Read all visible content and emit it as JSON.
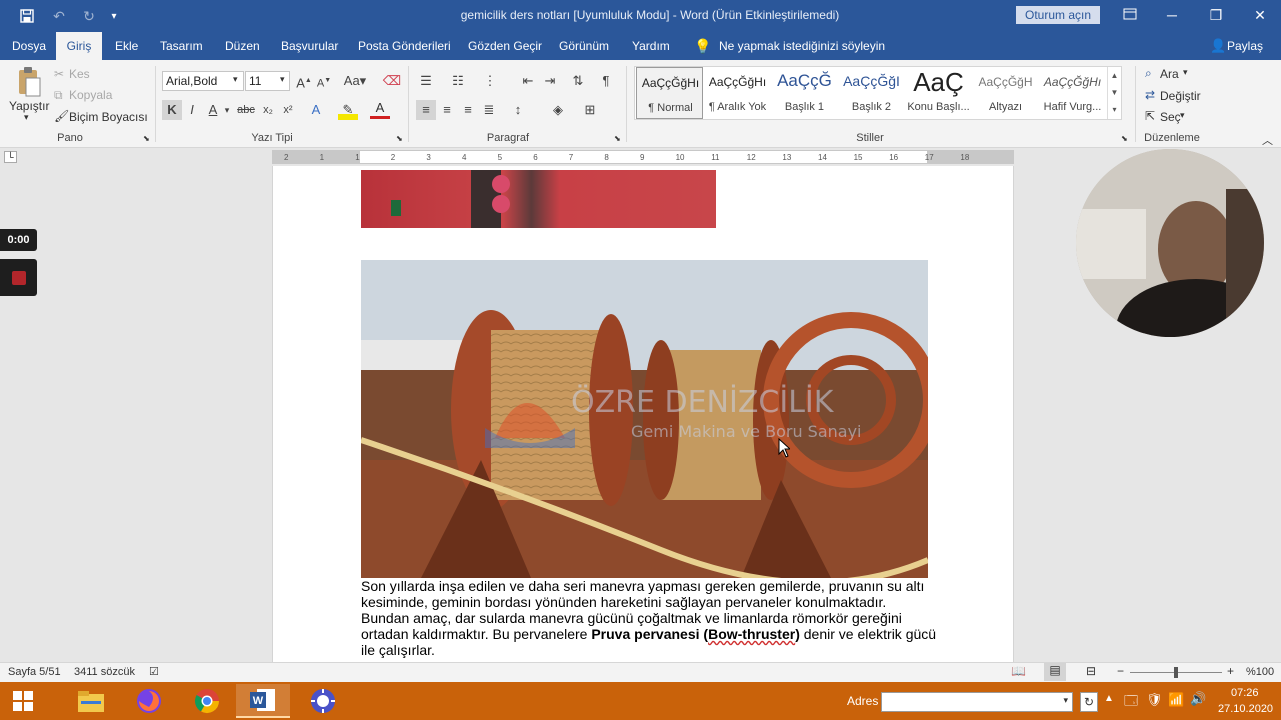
{
  "window": {
    "title": "gemicilik ders notları [Uyumluluk Modu]  -  Word (Ürün Etkinleştirilemedi)",
    "signin_label": "Oturum açın"
  },
  "tabs": [
    "Dosya",
    "Giriş",
    "Ekle",
    "Tasarım",
    "Düzen",
    "Başvurular",
    "Posta Gönderileri",
    "Gözden Geçir",
    "Görünüm",
    "Yardım"
  ],
  "tell_me": "Ne yapmak istediğinizi söyleyin",
  "share_label": "Paylaş",
  "clipboard": {
    "paste": "Yapıştır",
    "cut": "Kes",
    "copy": "Kopyala",
    "format_painter": "Biçim Boyacısı",
    "group": "Pano"
  },
  "font": {
    "name": "Arial,Bold",
    "size": "11",
    "bold": "K",
    "italic": "I",
    "underline": "A",
    "group": "Yazı Tipi"
  },
  "paragraph": {
    "group": "Paragraf"
  },
  "styles": {
    "items": [
      {
        "preview": "AaÇçĞğHı",
        "name": "¶ Normal"
      },
      {
        "preview": "AaÇçĞğHı",
        "name": "¶ Aralık Yok"
      },
      {
        "preview": "AaÇçĞ",
        "name": "Başlık 1"
      },
      {
        "preview": "AaÇçĞğI",
        "name": "Başlık 2"
      },
      {
        "preview": "AaÇ",
        "name": "Konu Başlı..."
      },
      {
        "preview": "AaÇçĞğH",
        "name": "Altyazı"
      },
      {
        "preview": "AaÇçĞğHı",
        "name": "Hafif Vurg..."
      }
    ],
    "group": "Stiller"
  },
  "editing": {
    "find": "Ara",
    "replace": "Değiştir",
    "select": "Seç",
    "group": "Düzenleme"
  },
  "ruler_ticks": [
    "2",
    "1",
    "1",
    "2",
    "3",
    "4",
    "5",
    "6",
    "7",
    "8",
    "9",
    "10",
    "11",
    "12",
    "13",
    "14",
    "15",
    "16",
    "17",
    "18"
  ],
  "document": {
    "watermark_title": "ÖZRE DENİZCİLİK",
    "watermark_sub": "Gemi Makina ve Boru Sanayi",
    "paragraph_lines": [
      "Son yıllarda inşa edilen ve daha seri manevra yapması gereken gemilerde, pruvanın su altı",
      "kesiminde, geminin bordası yönünden hareketini sağlayan pervaneler konulmaktadır.",
      "Bundan amaç, dar sularda manevra gücünü çoğaltmak ve limanlarda römorkör gereğini"
    ],
    "line4_a": "ortadan kaldırmaktır. Bu pervanelere ",
    "line4_bold": "Pruva pervanesi (",
    "line4_squig": "Bow-thruster",
    "line4_bold_end": ")",
    "line4_b": " denir ve elektrik gücü",
    "line5": "ile çalışırlar."
  },
  "status": {
    "page": "Sayfa 5/51",
    "words": "3411 sözcük",
    "zoom": "%100"
  },
  "recorder": {
    "timer": "0:00"
  },
  "taskbar": {
    "address_label": "Adres",
    "time": "07:26",
    "date": "27.10.2020"
  },
  "colors": {
    "word_blue": "#2b579a",
    "taskbar": "#c9620a"
  }
}
